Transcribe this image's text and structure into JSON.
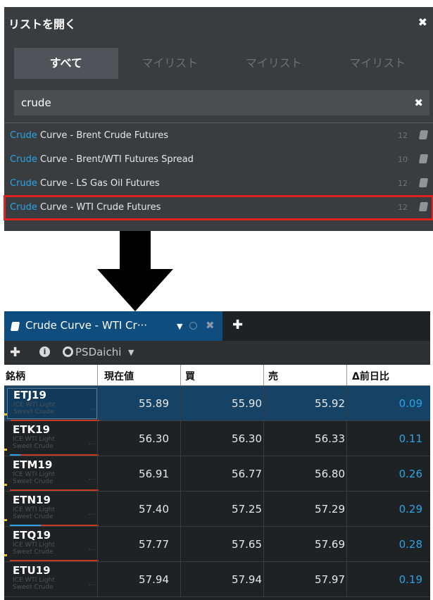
{
  "dialog": {
    "title": "リストを開く",
    "tabs": [
      {
        "label": "すべて",
        "active": true
      },
      {
        "label": "マイリスト",
        "active": false
      },
      {
        "label": "マイリスト",
        "active": false
      },
      {
        "label": "マイリスト",
        "active": false
      }
    ],
    "search_value": "crude",
    "items": [
      {
        "highlight": "Crude",
        "rest": " Curve - Brent Crude Futures",
        "count": "12",
        "selected": false
      },
      {
        "highlight": "Crude",
        "rest": " Curve - Brent/WTI Futures Spread",
        "count": "10",
        "selected": false
      },
      {
        "highlight": "Crude",
        "rest": " Curve - LS Gas Oil Futures",
        "count": "12",
        "selected": false
      },
      {
        "highlight": "Crude",
        "rest": " Curve - WTI Crude Futures",
        "count": "12",
        "selected": true
      }
    ]
  },
  "panel": {
    "tab_label": "Crude Curve - WTI Cr···",
    "account": "PSDaichi",
    "columns": [
      "銘柄",
      "現在値",
      "買",
      "売",
      "Δ前日比"
    ],
    "rows": [
      {
        "symbol": "ETJ19",
        "desc1": "ICE WTI Light",
        "desc2": "Sweet Crude",
        "last": "55.89",
        "bid": "55.90",
        "ask": "55.92",
        "change": "0.09",
        "selected": true,
        "blue": 0.0
      },
      {
        "symbol": "ETK19",
        "desc1": "ICE WTI Light",
        "desc2": "Sweet Crude",
        "last": "56.30",
        "bid": "56.30",
        "ask": "56.33",
        "change": "0.11",
        "selected": false,
        "blue": 0.12
      },
      {
        "symbol": "ETM19",
        "desc1": "ICE WTI Light",
        "desc2": "Sweet Crude",
        "last": "56.91",
        "bid": "56.77",
        "ask": "56.80",
        "change": "0.26",
        "selected": false,
        "blue": 0.0
      },
      {
        "symbol": "ETN19",
        "desc1": "ICE WTI Light",
        "desc2": "Sweet Crude",
        "last": "57.40",
        "bid": "57.25",
        "ask": "57.29",
        "change": "0.29",
        "selected": false,
        "blue": 0.35
      },
      {
        "symbol": "ETQ19",
        "desc1": "ICE WTI Light",
        "desc2": "Sweet Crude",
        "last": "57.77",
        "bid": "57.65",
        "ask": "57.69",
        "change": "0.28",
        "selected": false,
        "blue": 0.0
      },
      {
        "symbol": "ETU19",
        "desc1": "ICE WTI Light",
        "desc2": "Sweet Crude",
        "last": "57.94",
        "bid": "57.94",
        "ask": "57.97",
        "change": "0.19",
        "selected": false,
        "blue": 0.0
      }
    ]
  },
  "colors": {
    "dialog_bg": "#3a3d40",
    "highlight": "#2aa4e6",
    "selection_outline": "#e0211d",
    "panel_tab": "#0f4d7e",
    "row_selected": "#164266",
    "change": "#2aa4e6"
  },
  "icons": [
    "close-icon",
    "book-icon",
    "plus-icon",
    "info-icon",
    "globe-icon",
    "caret-down-icon",
    "arrow-down-icon"
  ]
}
